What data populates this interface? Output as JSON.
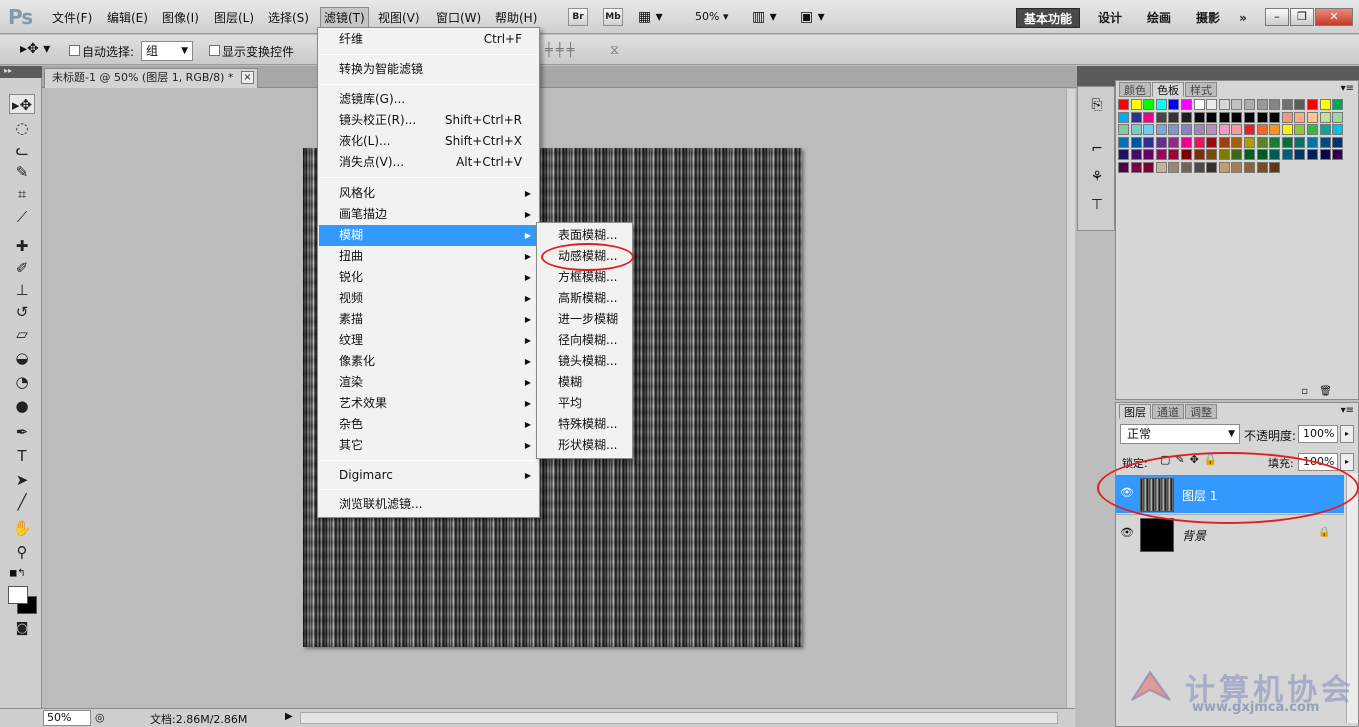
{
  "app": {
    "logo": "Ps"
  },
  "menubar": {
    "items": [
      "文件(F)",
      "编辑(E)",
      "图像(I)",
      "图层(L)",
      "选择(S)",
      "滤镜(T)",
      "视图(V)",
      "窗口(W)",
      "帮助(H)"
    ],
    "br": "Br",
    "mb": "Mb",
    "zoom": "50%",
    "workspaces": [
      "基本功能",
      "设计",
      "绘画",
      "摄影"
    ],
    "more": "»"
  },
  "options": {
    "auto_select_label": "自动选择:",
    "auto_select_value": "组",
    "show_transform_label": "显示变换控件"
  },
  "document": {
    "tab_title": "未标题-1 @ 50% (图层 1, RGB/8) *",
    "close": "×"
  },
  "filter_menu": {
    "items": [
      {
        "label": "纤维",
        "shortcut": "Ctrl+F"
      },
      {
        "label": "转换为智能滤镜"
      },
      {
        "label": "滤镜库(G)..."
      },
      {
        "label": "镜头校正(R)...",
        "shortcut": "Shift+Ctrl+R"
      },
      {
        "label": "液化(L)...",
        "shortcut": "Shift+Ctrl+X"
      },
      {
        "label": "消失点(V)...",
        "shortcut": "Alt+Ctrl+V"
      },
      {
        "label": "风格化",
        "arrow": "▶"
      },
      {
        "label": "画笔描边",
        "arrow": "▶"
      },
      {
        "label": "模糊",
        "arrow": "▶"
      },
      {
        "label": "扭曲",
        "arrow": "▶"
      },
      {
        "label": "锐化",
        "arrow": "▶"
      },
      {
        "label": "视频",
        "arrow": "▶"
      },
      {
        "label": "素描",
        "arrow": "▶"
      },
      {
        "label": "纹理",
        "arrow": "▶"
      },
      {
        "label": "像素化",
        "arrow": "▶"
      },
      {
        "label": "渲染",
        "arrow": "▶"
      },
      {
        "label": "艺术效果",
        "arrow": "▶"
      },
      {
        "label": "杂色",
        "arrow": "▶"
      },
      {
        "label": "其它",
        "arrow": "▶"
      },
      {
        "label": "Digimarc",
        "arrow": "▶"
      },
      {
        "label": "浏览联机滤镜..."
      }
    ]
  },
  "blur_submenu": {
    "items": [
      "表面模糊...",
      "动感模糊...",
      "方框模糊...",
      "高斯模糊...",
      "进一步模糊",
      "径向模糊...",
      "镜头模糊...",
      "模糊",
      "平均",
      "特殊模糊...",
      "形状模糊..."
    ]
  },
  "swatch_panel": {
    "tabs": [
      "颜色",
      "色板",
      "样式"
    ],
    "colors": [
      "#ff0000",
      "#ffff00",
      "#00ff00",
      "#00ffff",
      "#0000ff",
      "#ff00ff",
      "#ffffff",
      "#ebebeb",
      "#d6d6d6",
      "#c2c2c2",
      "#adadad",
      "#999999",
      "#858585",
      "#707070",
      "#5c5c5c",
      "#ff0000",
      "#ffff00",
      "#00a651",
      "#00aeef",
      "#2e3192",
      "#ec008c",
      "#474747",
      "#333333",
      "#1f1f1f",
      "#0a0a0a",
      "#000000",
      "#000000",
      "#000000",
      "#000000",
      "#000000",
      "#000000",
      "#f7977a",
      "#f9ad81",
      "#fdc68a",
      "#c4df9b",
      "#a3d39c",
      "#82ca9d",
      "#7bcdc8",
      "#6ecff6",
      "#7ea7d8",
      "#8493ca",
      "#8882be",
      "#a187be",
      "#bc8dbf",
      "#f49ac2",
      "#f6989d",
      "#ed1c24",
      "#f26522",
      "#f7941d",
      "#fff200",
      "#8dc63f",
      "#39b54a",
      "#00a99d",
      "#00bff3",
      "#0072bc",
      "#0054a6",
      "#2e3192",
      "#662d91",
      "#92278f",
      "#ec008c",
      "#ed145b",
      "#9e0b0f",
      "#a0410d",
      "#a36209",
      "#aba000",
      "#598527",
      "#197b30",
      "#007236",
      "#00746b",
      "#0076a3",
      "#004b80",
      "#003471",
      "#1b1464",
      "#440e62",
      "#630460",
      "#9e005d",
      "#9e0039",
      "#790000",
      "#7b2e00",
      "#7d4900",
      "#827b00",
      "#406618",
      "#005e20",
      "#005826",
      "#005952",
      "#005b7f",
      "#003663",
      "#002157",
      "#0d004c",
      "#32004b",
      "#4b0049",
      "#7b0046",
      "#7a0026",
      "#c7b299",
      "#998675",
      "#736357",
      "#534741",
      "#37302a",
      "#c69c6d",
      "#a67c52",
      "#8c6239",
      "#754c24",
      "#603913"
    ],
    "footer_icons": [
      "new-swatch",
      "delete-swatch"
    ]
  },
  "layers_panel": {
    "tabs": [
      "图层",
      "通道",
      "调整"
    ],
    "blend_mode": "正常",
    "opacity_label": "不透明度:",
    "opacity_value": "100%",
    "lock_label": "锁定:",
    "fill_label": "填充:",
    "fill_value": "100%",
    "layers": [
      {
        "name": "图层 1",
        "selected": true
      },
      {
        "name": "背景",
        "selected": false
      }
    ]
  },
  "statusbar": {
    "zoom": "50%",
    "doc_info": "文档:2.86M/2.86M"
  },
  "watermark": {
    "text": "计算机协会",
    "url": "www.gxjmca.com"
  }
}
